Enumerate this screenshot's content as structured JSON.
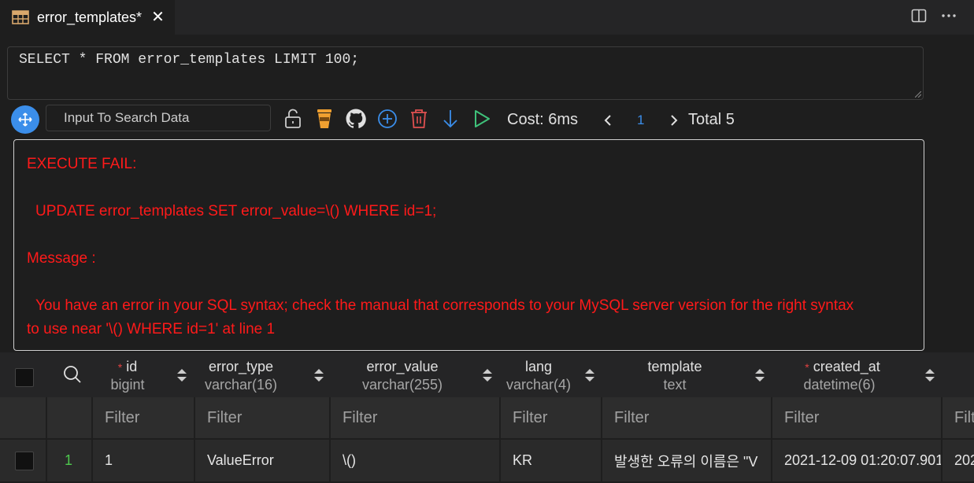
{
  "tab": {
    "title": "error_templates*"
  },
  "query": {
    "text": "SELECT * FROM error_templates LIMIT 100;"
  },
  "toolbar": {
    "search_placeholder": "Input To Search Data",
    "cost": "Cost: 6ms",
    "page": "1",
    "total": "Total 5"
  },
  "error": {
    "title": "EXECUTE FAIL:",
    "statement": "UPDATE error_templates SET error_value=\\() WHERE id=1;",
    "message_label": "Message :",
    "message_line1": "You have an error in your SQL syntax; check the manual that corresponds to your MySQL server version for the right syntax",
    "message_line2": "to use near '\\() WHERE id=1' at line 1"
  },
  "columns": [
    {
      "name": "id",
      "type": "bigint",
      "required": true
    },
    {
      "name": "error_type",
      "type": "varchar(16)",
      "required": false
    },
    {
      "name": "error_value",
      "type": "varchar(255)",
      "required": false
    },
    {
      "name": "lang",
      "type": "varchar(4)",
      "required": false
    },
    {
      "name": "template",
      "type": "text",
      "required": false
    },
    {
      "name": "created_at",
      "type": "datetime(6)",
      "required": true
    }
  ],
  "required_mark": "*",
  "filter_label": "Filter",
  "filter_label_cut": "Filt",
  "rows": [
    {
      "index": "1",
      "id": "1",
      "error_type": "ValueError",
      "error_value": "\\()",
      "lang": "KR",
      "template": "발생한 오류의 이름은 \"V",
      "created_at": "2021-12-09 01:20:07.901",
      "next": "202"
    }
  ],
  "colors": {
    "accent": "#3b8eea",
    "error": "#ff1a1a",
    "row_index": "#4ec94e"
  }
}
